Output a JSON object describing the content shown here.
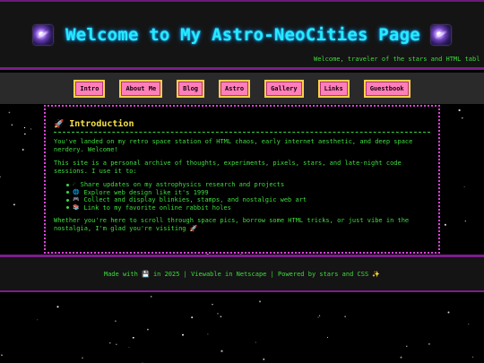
{
  "header": {
    "title": "Welcome to My Astro-NeoCities Page",
    "left_icon": "galaxy-icon",
    "right_icon": "galaxy-icon",
    "marquee": "Welcome, traveler of the stars and HTML tabl"
  },
  "nav": {
    "items": [
      "Intro",
      "About Me",
      "Blog",
      "Astro",
      "Gallery",
      "Links",
      "Guestbook"
    ]
  },
  "intro": {
    "icon": "rocket-icon",
    "heading": "Introduction",
    "para1": "You've landed on my retro space station of HTML chaos, early internet aesthetic, and deep space nerdery. Welcome!",
    "para2": "This site is a personal archive of thoughts, experiments, pixels, stars, and late-night code sessions. I use it to:",
    "list": [
      {
        "icon": "☄",
        "text": "Share updates on my astrophysics research and projects"
      },
      {
        "icon": "🌐",
        "text": "Explore web design like it's 1999"
      },
      {
        "icon": "🎮",
        "text": "Collect and display blinkies, stamps, and nostalgic web art"
      },
      {
        "icon": "📚",
        "text": "Link to my favorite online rabbit holes"
      }
    ],
    "para3": "Whether you're here to scroll through space pics, borrow some HTML tricks, or just vibe in the nostalgia, I'm glad you're visiting 🚀"
  },
  "footer": {
    "text": "Made with 💾 in 2025 | Viewable in Netscape | Powered by stars and CSS ✨"
  },
  "colors": {
    "title": "#27e9ff",
    "nav_button": "#ff7fb9",
    "nav_border": "#ffd04a",
    "text_green": "#3fdc3f",
    "heading_yellow": "#f5e14a",
    "border_purple": "#7a1f8a",
    "panel_border": "#e040e0"
  }
}
